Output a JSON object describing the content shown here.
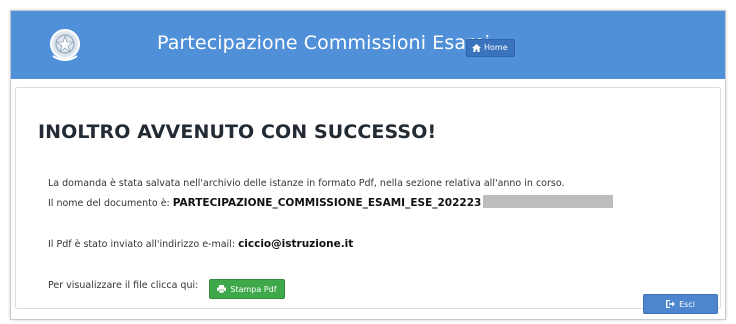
{
  "colors": {
    "header_bg": "#5090d8",
    "success_btn": "#3ea84a",
    "primary_btn": "#4d86cf"
  },
  "header": {
    "title": "Partecipazione Commissioni Esami",
    "home_label": "Home",
    "emblem_icon": "italian-republic-emblem-icon",
    "home_icon": "home-icon"
  },
  "message": {
    "title": "INOLTRO AVVENUTO CON SUCCESSO!",
    "line1": "La domanda è stata salvata nell'archivio delle istanze in formato Pdf, nella sezione relativa all'anno in corso.",
    "doc_name_label": "Il nome del documento è:",
    "doc_name_value": "PARTECIPAZIONE_COMMISSIONE_ESAMI_ESE_202223",
    "email_text": "Il Pdf è stato inviato all'indirizzo e-mail:",
    "email_value": "ciccio@istruzione.it",
    "view_text": "Per visualizzare il file clicca qui:",
    "pdf_button_label": "Stampa Pdf",
    "pdf_icon": "print-icon"
  },
  "actions": {
    "exit_label": "Esci",
    "exit_icon": "sign-out-icon"
  }
}
